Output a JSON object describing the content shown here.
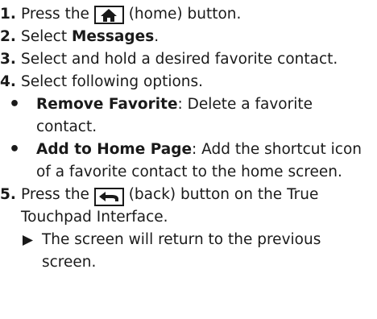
{
  "steps": [
    {
      "num": "1.",
      "pre": "Press the",
      "icon": "home-icon",
      "post": "(home) button."
    },
    {
      "num": "2.",
      "pre": "Select ",
      "bold": "Messages",
      "post": "."
    },
    {
      "num": "3.",
      "text": "Select and hold a desired favorite contact."
    },
    {
      "num": "4.",
      "text": "Select following options.",
      "options": [
        {
          "term": "Remove Favorite",
          "desc": ": Delete a favorite contact."
        },
        {
          "term": "Add to Home Page",
          "desc": ": Add the shortcut icon of a favorite contact to the home screen."
        }
      ]
    },
    {
      "num": "5.",
      "pre": "Press the",
      "icon": "back-icon",
      "post": "(back) button on the True Touchpad Interface.",
      "result": "The screen will return to the previous screen."
    }
  ]
}
